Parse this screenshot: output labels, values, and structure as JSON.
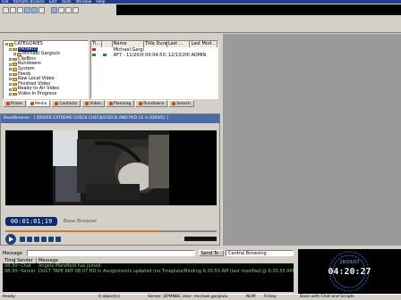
{
  "menu": {
    "items": [
      "File",
      "Remote Browse",
      "Edit",
      "Tools",
      "Window",
      "Help"
    ]
  },
  "tree": {
    "items": [
      {
        "label": "CATEGORIES",
        "level": 0
      },
      {
        "label": "PRIVATE",
        "level": 1,
        "selected": true
      },
      {
        "label": "Michael Gargiulo",
        "level": 2
      },
      {
        "label": "ClipBins",
        "level": 1
      },
      {
        "label": "Rundowns",
        "level": 1
      },
      {
        "label": "System",
        "level": 1
      },
      {
        "label": "Feeds",
        "level": 1
      },
      {
        "label": "Raw Local Video",
        "level": 1
      },
      {
        "label": "Finished Video",
        "level": 1
      },
      {
        "label": "Ready to Air Video",
        "level": 1
      },
      {
        "label": "Video In Progress",
        "level": 1
      }
    ]
  },
  "table": {
    "columns": [
      "Ti...",
      "",
      "Name",
      "Title Duration",
      "Last ...",
      "Last Mod..."
    ],
    "rows": [
      [
        "",
        "",
        "Michael Gargiulo",
        "",
        "",
        ""
      ],
      [
        "",
        "",
        "AF7 - 11/20/09...",
        "00:04:50:26",
        "12/13/2009 ...",
        "ADMIN"
      ]
    ]
  },
  "tabs": [
    "Prime",
    "Media",
    "Contacts",
    "Video",
    "Planning",
    "Rundowns",
    "Search"
  ],
  "browser": {
    "title": "BaseBrowser - [ DRIVER EXTREME CHECK CHECK/CHECK AND PAD 11 in (DRIVE) ]"
  },
  "player": {
    "timecode": "00:01:01;19",
    "label": "Base Browser",
    "progress_fraction": 0.72
  },
  "chat": {
    "message_label": "Message",
    "send_label": "Send To :",
    "send_target": "Central Browsing",
    "columns": [
      "Time",
      "Sender",
      "Message"
    ],
    "rows": [
      {
        "time": "08:30",
        "sender": "~Chat",
        "message": "Angela Morefield has joined."
      },
      {
        "time": "08:30",
        "sender": "~Server",
        "message": "DUCT TAPE ART 08:07 HD in Assignments updated (no Tmeplate/Binding 6:30:55 AM (last modified @ 6:30:55 AM) Status: Taped"
      }
    ]
  },
  "clock": {
    "date": "28/03/07",
    "time": "04:20:27"
  },
  "status": {
    "ready": "Ready",
    "objects": "0 object(s)",
    "server": "Server: DPMNBC User: michael.gargiulo",
    "num": "NUM",
    "date": "Friday",
    "info": "Base with Chat and Scripts"
  },
  "colors": {
    "accent": "#4a6aa8",
    "title_bar": "#1f3d8a",
    "timecode_bg": "#0e2a6a",
    "chat_bg": "#000000",
    "chat_text": "#7bd67b",
    "progress": "#d07a2a"
  }
}
